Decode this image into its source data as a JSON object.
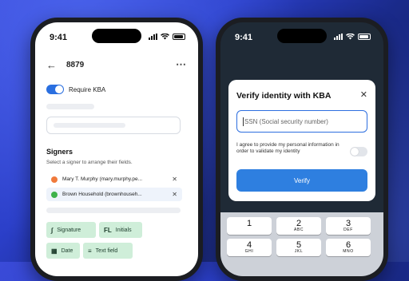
{
  "left_phone": {
    "status_time": "9:41",
    "header": {
      "back_icon": "back-arrow-icon",
      "title": "8879",
      "more_icon": "more-icon"
    },
    "require_kba_label": "Require KBA",
    "signers": {
      "title": "Signers",
      "subtitle": "Select a signer to arrange their fields.",
      "items": [
        {
          "name": "Mary T. Murphy (mary.murphy.pe...",
          "color": "#f07a3c"
        },
        {
          "name": "Brown Household (brownhouseh...",
          "color": "#3fb24a"
        }
      ]
    },
    "fields": [
      {
        "label": "Signature",
        "icon": "signature-icon",
        "glyph": "∫"
      },
      {
        "label": "Initials",
        "icon": "initials-icon",
        "glyph": "FL"
      },
      {
        "label": "Date",
        "icon": "calendar-icon",
        "glyph": "▦"
      },
      {
        "label": "Text field",
        "icon": "text-field-icon",
        "glyph": "≡"
      }
    ]
  },
  "right_phone": {
    "status_time": "9:41",
    "modal": {
      "title": "Verify identity with KBA",
      "ssn_placeholder": "SSN (Social security number)",
      "agree_text": "I agree to provide my personal information in order to validate my identity",
      "verify_label": "Verify"
    },
    "keypad": [
      {
        "num": "1",
        "letters": ""
      },
      {
        "num": "2",
        "letters": "ABC"
      },
      {
        "num": "3",
        "letters": "DEF"
      },
      {
        "num": "4",
        "letters": "GHI"
      },
      {
        "num": "5",
        "letters": "JKL"
      },
      {
        "num": "6",
        "letters": "MNO"
      }
    ]
  },
  "colors": {
    "accent": "#2e7fe0",
    "chip_green": "#cfeed9"
  }
}
